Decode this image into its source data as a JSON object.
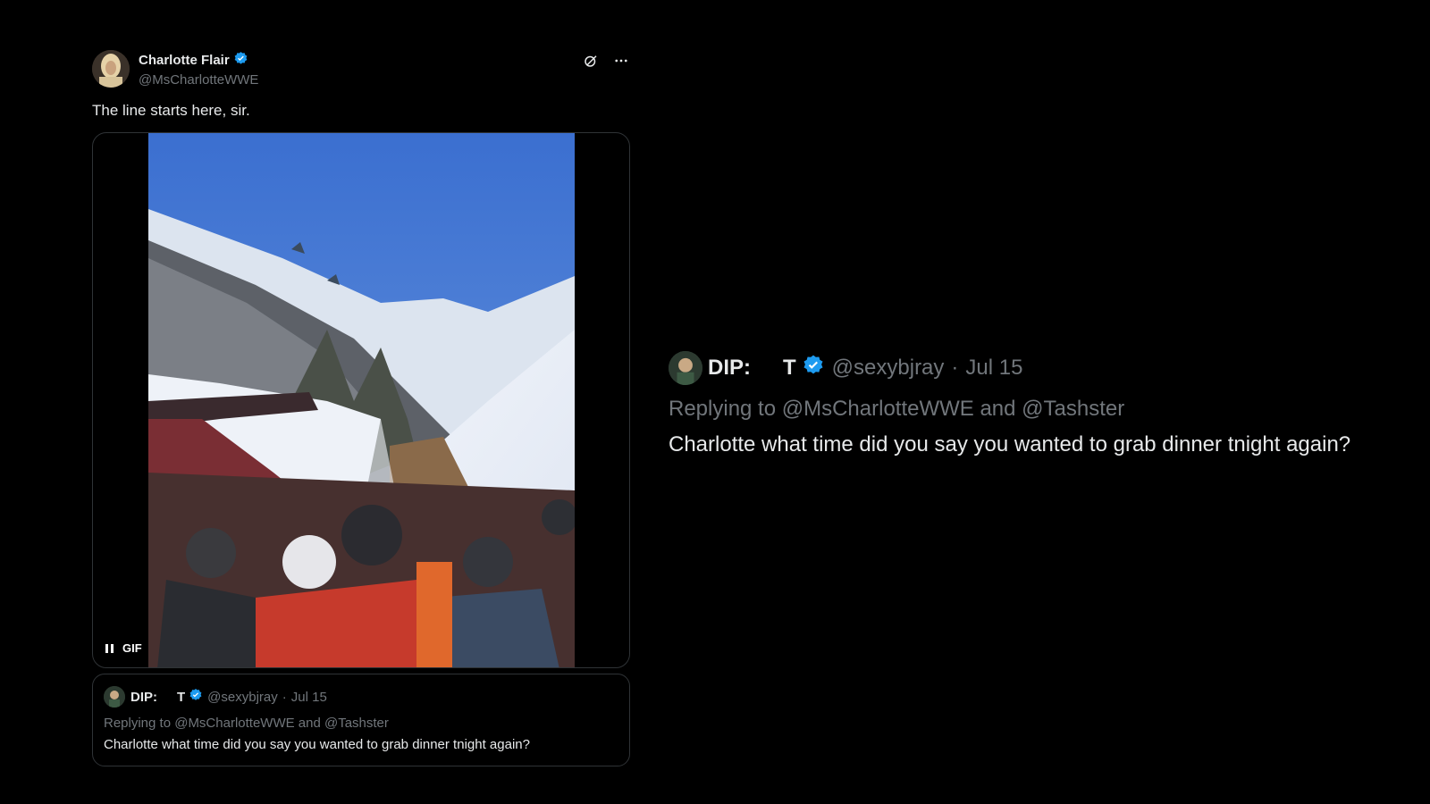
{
  "tweet": {
    "author": {
      "name": "Charlotte Flair",
      "handle": "@MsCharlotteWWE",
      "verified": true
    },
    "text": "The line starts here, sir.",
    "actions": {
      "icon_grok": "grok-icon",
      "icon_more": "more-icon"
    },
    "media": {
      "type": "GIF",
      "badge": "GIF",
      "state": "playing",
      "control_icon": "pause-icon"
    }
  },
  "quoted_tweet": {
    "author_name_part1": "DIP:",
    "author_name_part2": "T",
    "verified": true,
    "handle": "@sexybjray",
    "separator": "·",
    "date": "Jul 15",
    "replying_to": "Replying to @MsCharlotteWWE and @Tashster",
    "text": "Charlotte what time did you say you wanted to grab dinner tnight again?"
  },
  "zoomed_quote": {
    "author_name_part1": "DIP:",
    "author_name_part2": "T",
    "verified": true,
    "handle": "@sexybjray",
    "separator": "·",
    "date": "Jul 15",
    "replying_to": "Replying to @MsCharlotteWWE and @Tashster",
    "text": "Charlotte what time did you say you wanted to grab dinner tnight again?"
  },
  "colors": {
    "background": "#000000",
    "text": "#e7e9ea",
    "muted": "#71767b",
    "verified": "#1d9bf0",
    "border": "#2f3336"
  }
}
